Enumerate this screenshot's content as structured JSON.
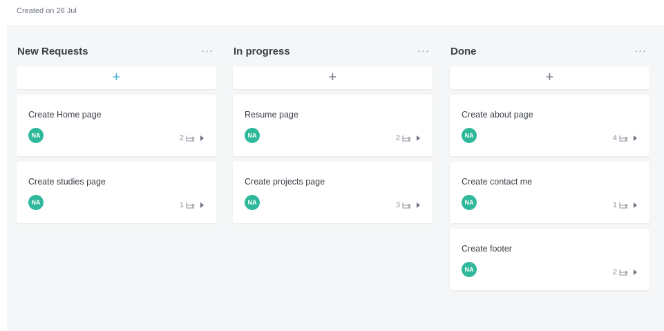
{
  "header": {
    "created_text": "Created on 26 Jul"
  },
  "columns": [
    {
      "title": "New Requests",
      "more_label": "···",
      "add_label": "+",
      "cards": [
        {
          "title": "Create Home page",
          "assignee": "NA",
          "subtasks": "2"
        },
        {
          "title": "Create studies page",
          "assignee": "NA",
          "subtasks": "1"
        }
      ]
    },
    {
      "title": "In progress",
      "more_label": "···",
      "add_label": "+",
      "cards": [
        {
          "title": "Resume page",
          "assignee": "NA",
          "subtasks": "2"
        },
        {
          "title": "Create projects page",
          "assignee": "NA",
          "subtasks": "3"
        }
      ]
    },
    {
      "title": "Done",
      "more_label": "···",
      "add_label": "+",
      "cards": [
        {
          "title": "Create about page",
          "assignee": "NA",
          "subtasks": "4"
        },
        {
          "title": "Create contact me",
          "assignee": "NA",
          "subtasks": "1"
        },
        {
          "title": "Create footer",
          "assignee": "NA",
          "subtasks": "2"
        }
      ]
    }
  ],
  "colors": {
    "avatar": "#2fb89a",
    "accent": "#3ea8d8",
    "board_bg": "#f5f6f7"
  },
  "icons": {
    "subtask": "subtask-icon",
    "expand": "caret-right-icon",
    "add": "plus-icon",
    "more": "ellipsis-icon"
  }
}
